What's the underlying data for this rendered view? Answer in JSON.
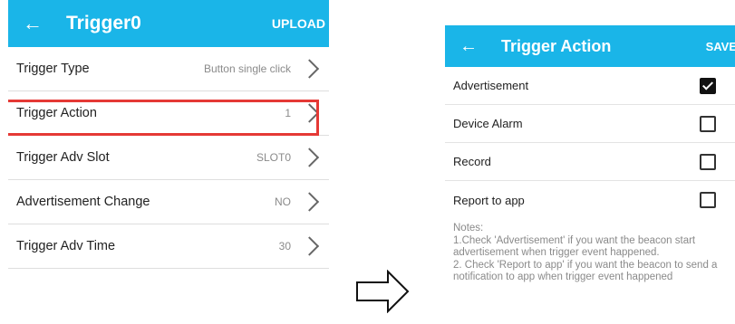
{
  "left_screen": {
    "title": "Trigger0",
    "action_label": "UPLOAD",
    "rows": [
      {
        "label": "Trigger Type",
        "value": "Button single click"
      },
      {
        "label": "Trigger Action",
        "value": "1"
      },
      {
        "label": "Trigger Adv Slot",
        "value": "SLOT0"
      },
      {
        "label": "Advertisement Change",
        "value": "NO"
      },
      {
        "label": "Trigger Adv Time",
        "value": "30"
      }
    ],
    "highlighted_row": "Trigger Action"
  },
  "right_screen": {
    "title": "Trigger Action",
    "action_label": "SAVE",
    "options": [
      {
        "label": "Advertisement",
        "checked": true
      },
      {
        "label": "Device Alarm",
        "checked": false
      },
      {
        "label": "Record",
        "checked": false
      },
      {
        "label": "Report to app",
        "checked": false
      }
    ],
    "notes": {
      "heading": "Notes:",
      "line1": "1.Check 'Advertisement' if you want the beacon start advertisement when trigger event happened.",
      "line2": "2. Check 'Report to app' if you want the beacon to send a notification to app when trigger event happened"
    }
  },
  "colors": {
    "appbar": "#1ab5e8",
    "highlight": "#e53935"
  },
  "icons": {
    "back": "back-arrow-icon",
    "chevron": "chevron-right-icon",
    "flow": "right-arrow-icon"
  }
}
